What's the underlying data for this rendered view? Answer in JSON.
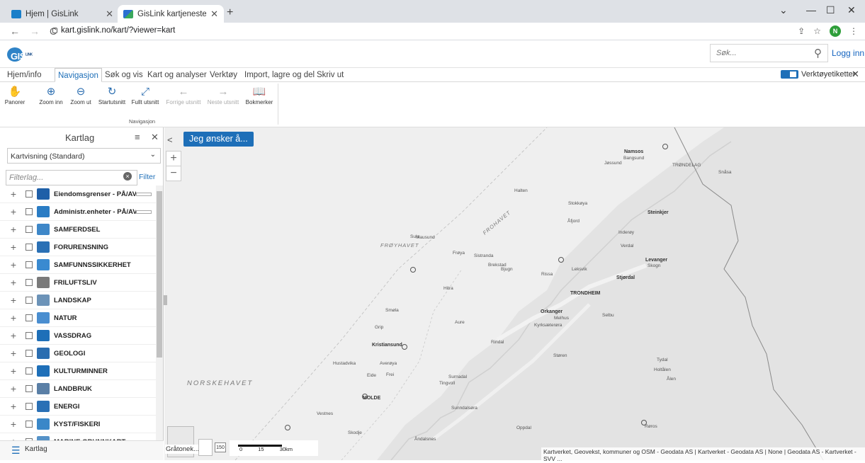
{
  "browser": {
    "tabs": [
      {
        "title": "Hjem | GisLink",
        "active": false
      },
      {
        "title": "GisLink kartjeneste",
        "active": true
      }
    ],
    "url": "kart.gislink.no/kart/?viewer=kart",
    "avatar_letter": "N"
  },
  "header": {
    "logo_text": "GIS",
    "logo_sub": "LINK",
    "search_placeholder": "Søk...",
    "login_label": "Logg inn"
  },
  "menu": {
    "tabs": [
      "Hjem/info",
      "Navigasjon",
      "Søk og vis",
      "Kart og analyser",
      "Verktøy",
      "Import, lagre og del",
      "Skriv ut"
    ],
    "active_index": 1,
    "toggle_label": "Verktøyetiketter",
    "toggle_on": true
  },
  "toolbar": {
    "tools": [
      {
        "label": "Panorer",
        "icon": "hand-icon",
        "enabled": true
      },
      {
        "label": "Zoom inn",
        "icon": "zoom-in-icon",
        "enabled": true
      },
      {
        "label": "Zoom ut",
        "icon": "zoom-out-icon",
        "enabled": true
      },
      {
        "label": "Startutsnitt",
        "icon": "refresh-icon",
        "enabled": true
      },
      {
        "label": "Fullt utsnitt",
        "icon": "full-extent-icon",
        "enabled": true
      },
      {
        "label": "Forrige utsnitt",
        "icon": "back-arrow-icon",
        "enabled": false
      },
      {
        "label": "Neste utsnitt",
        "icon": "forward-arrow-icon",
        "enabled": false
      },
      {
        "label": "Bokmerker",
        "icon": "bookmark-icon",
        "enabled": true
      }
    ],
    "group_label": "Navigasjon"
  },
  "panel": {
    "title": "Kartlag",
    "basemap_select": "Kartvisning (Standard)",
    "filter_placeholder": "Filterlag...",
    "filter_button": "Filter",
    "layers": [
      {
        "name": "Eiendomsgrenser - PÅ/AV",
        "icon": "property-icon",
        "slider": true
      },
      {
        "name": "Administr.enheter - PÅ/AV",
        "icon": "admin-units-icon",
        "slider": true
      },
      {
        "name": "SAMFERDSEL",
        "icon": "transport-icon",
        "slider": false
      },
      {
        "name": "FORURENSNING",
        "icon": "pollution-icon",
        "slider": false
      },
      {
        "name": "SAMFUNNSSIKKERHET",
        "icon": "safety-icon",
        "slider": false
      },
      {
        "name": "FRILUFTSLIV",
        "icon": "outdoor-icon",
        "slider": false
      },
      {
        "name": "LANDSKAP",
        "icon": "landscape-icon",
        "slider": false
      },
      {
        "name": "NATUR",
        "icon": "nature-icon",
        "slider": false
      },
      {
        "name": "VASSDRAG",
        "icon": "water-drop-icon",
        "slider": false
      },
      {
        "name": "GEOLOGI",
        "icon": "geology-icon",
        "slider": false
      },
      {
        "name": "KULTURMINNER",
        "icon": "heritage-icon",
        "slider": false
      },
      {
        "name": "LANDBRUK",
        "icon": "agriculture-icon",
        "slider": false
      },
      {
        "name": "ENERGI",
        "icon": "energy-icon",
        "slider": false
      },
      {
        "name": "KYST/FISKERI",
        "icon": "fishery-icon",
        "slider": false
      },
      {
        "name": "MARINE GRUNNKART",
        "icon": "marine-icon",
        "slider": true
      }
    ],
    "footer_label": "Kartlag"
  },
  "map": {
    "action_button": "Jeg ønsker å...",
    "basemap_switch_label": "Gråtonek...",
    "scale_number": "150",
    "scale_labels": [
      "0",
      "15",
      "30km"
    ],
    "attribution": "Kartverket, Geovekst, kommuner og OSM - Geodata AS | Kartverket - Geodata AS | None | Geodata AS - Kartverket - SVV ...",
    "sea_labels": [
      "NORSKEHAVET",
      "FRØYHAVET",
      "FROHAVET"
    ],
    "place_labels": [
      "Namsos",
      "Bangsund",
      "Jøssund",
      "TRØNDELAG",
      "Snåsa",
      "Halten",
      "Stokkøya",
      "Åfjord",
      "Steinkjer",
      "Inderøy",
      "Levanger",
      "Skogn",
      "Verdal",
      "Sula",
      "Mausund",
      "Frøya",
      "Sistranda",
      "Bjugn",
      "Brekstad",
      "Rissa",
      "Leksvik",
      "Stjørdal",
      "Hitra",
      "TRONDHEIM",
      "Melhus",
      "Selbu",
      "Orkanger",
      "Kyrksæterøra",
      "Smøla",
      "Aure",
      "Kristiansund",
      "Rindal",
      "Støren",
      "Oppdal",
      "Røros",
      "MOLDE",
      "Sunndalsøra",
      "Surnadal",
      "Tydal",
      "Holtålen",
      "Ålen",
      "Hustadvika",
      "Averøya",
      "Tingvoll",
      "Eide",
      "Frei",
      "Grip",
      "Skodje",
      "Åndalsnes",
      "Vestnes"
    ]
  },
  "colors": {
    "accent": "#1e6fb8",
    "map_land": "#e9e9e9",
    "map_water": "#f6f6f6"
  }
}
